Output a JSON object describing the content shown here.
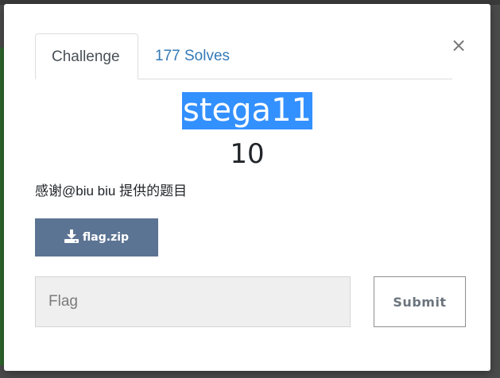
{
  "modal": {
    "close_glyph": "×",
    "tabs": [
      {
        "label": "Challenge",
        "active": true
      },
      {
        "label": "177 Solves",
        "active": false
      }
    ],
    "challenge": {
      "name": "stega11",
      "points": "10",
      "description": "感谢@biu biu 提供的题目"
    },
    "file": {
      "label": "flag.zip",
      "icon": "download-icon"
    },
    "flag_input": {
      "placeholder": "Flag",
      "value": ""
    },
    "submit_label": "Submit"
  },
  "colors": {
    "title_highlight": "#3390ff",
    "file_button": "#5c7493",
    "link": "#337ab7"
  }
}
